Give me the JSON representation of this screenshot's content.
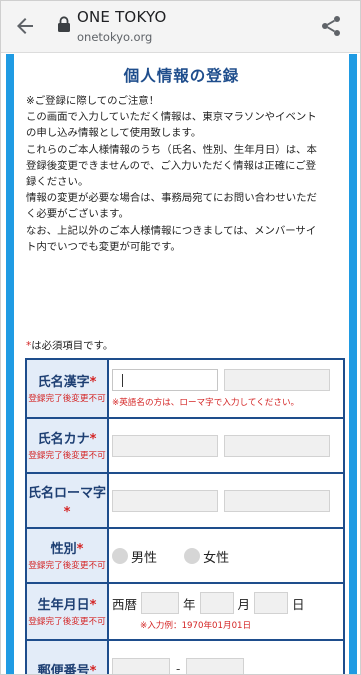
{
  "browser": {
    "title": "ONE TOKYO",
    "url": "onetokyo.org"
  },
  "page": {
    "heading": "個人情報の登録",
    "notice_lines": [
      "※ご登録に際してのご注意！",
      "この画面で入力していただく情報は、東京マラソンやイベント",
      "の申し込み情報として使用致します。",
      "これらのご本人様情報のうち（氏名、性別、生年月日）は、本",
      "登録後変更できませんので、ご入力いただく情報は正確にご登",
      "録ください。",
      "情報の変更が必要な場合は、事務局宛てにお問い合わせいただ",
      "く必要がございます。",
      "なお、上記以外のご本人様情報につきましては、メンバーサイ",
      "ト内でいつでも変更が可能です。"
    ],
    "required_note": "は必須項目です。",
    "required_star": "*"
  },
  "form": {
    "name_kanji": {
      "label": "氏名漢字",
      "sub": "登録完了後変更不可",
      "hint": "※英語名の方は、ローマ字で入力してください。"
    },
    "name_kana": {
      "label": "氏名カナ",
      "sub": "登録完了後変更不可"
    },
    "name_roman": {
      "label": "氏名ローマ字"
    },
    "gender": {
      "label": "性別",
      "sub": "登録完了後変更不可",
      "options": [
        "男性",
        "女性"
      ]
    },
    "dob": {
      "label": "生年月日",
      "sub": "登録完了後変更不可",
      "era": "西暦",
      "year": "年",
      "month": "月",
      "day": "日",
      "hint": "※入力例：1970年01月01日"
    },
    "postal": {
      "label": "郵便番号",
      "sep": "-"
    }
  },
  "colors": {
    "accent": "#1f9be3",
    "heading": "#1e4d8c",
    "required": "#d42525",
    "label_bg": "#e3ecf8"
  }
}
